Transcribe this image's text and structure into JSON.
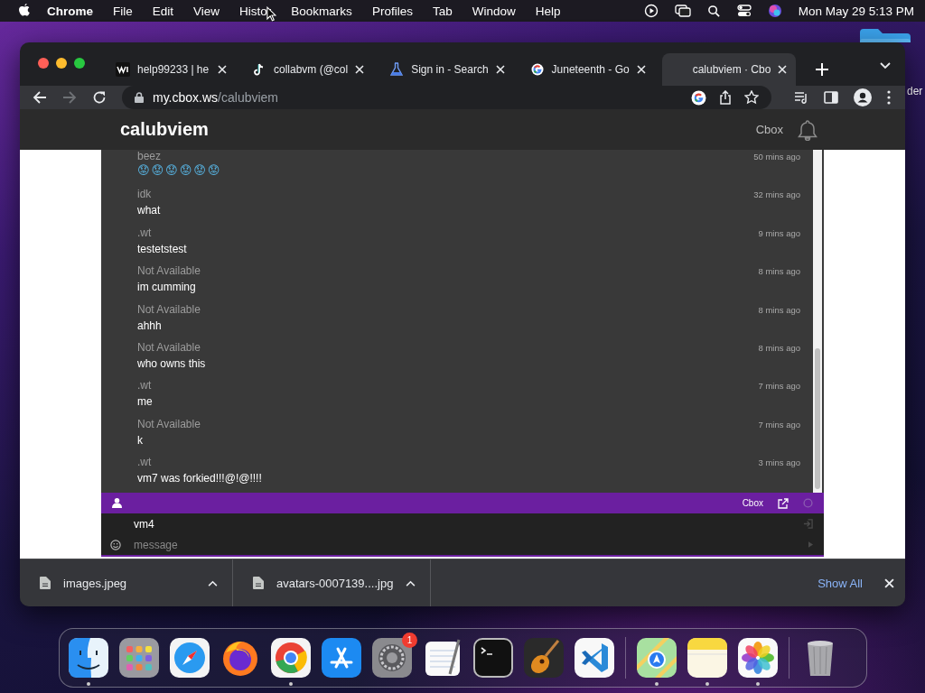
{
  "menu_bar": {
    "app": "Chrome",
    "menus": [
      "File",
      "Edit",
      "View",
      "Histor",
      "Bookmarks",
      "Profiles",
      "Tab",
      "Window",
      "Help"
    ],
    "clock": "Mon May 29  5:13 PM"
  },
  "desktop": {
    "folder_label": "der"
  },
  "tabs": [
    {
      "title": "help99233 | he",
      "kind": "wix",
      "selected": false
    },
    {
      "title": "collabvm (@col",
      "kind": "note",
      "selected": false
    },
    {
      "title": "Sign in - Search",
      "kind": "flask",
      "selected": false
    },
    {
      "title": "Juneteenth - Go",
      "kind": "google",
      "selected": false
    },
    {
      "title": "calubviem · Cbo",
      "selected": true
    }
  ],
  "toolbar": {
    "back_enabled": true,
    "forward_enabled": false,
    "host": "my.cbox.ws",
    "path": "/calubviem"
  },
  "page": {
    "site_title": "calubviem",
    "header_link": "Cbox",
    "messages": [
      {
        "author": "beez",
        "time": "50 mins ago",
        "text": "😟😟😟😟😟😟",
        "kind": "emoji"
      },
      {
        "author": "idk",
        "time": "32 mins ago",
        "text": "what"
      },
      {
        "author": ".wt",
        "time": "9 mins ago",
        "text": "testetstest"
      },
      {
        "author": "Not Available",
        "time": "8 mins ago",
        "text": "im cumming"
      },
      {
        "author": "Not Available",
        "time": "8 mins ago",
        "text": "ahhh"
      },
      {
        "author": "Not Available",
        "time": "8 mins ago",
        "text": "who owns this"
      },
      {
        "author": ".wt",
        "time": "7 mins ago",
        "text": "me"
      },
      {
        "author": "Not Available",
        "time": "7 mins ago",
        "text": "k"
      },
      {
        "author": ".wt",
        "time": "3 mins ago",
        "text": "vm7 was forkied!!!@!@!!!!"
      }
    ],
    "bar_label": "Cbox",
    "name_value": "vm4",
    "message_placeholder": "message"
  },
  "downloads": {
    "items": [
      {
        "name": "images.jpeg"
      },
      {
        "name": "avatars-0007139....jpg"
      }
    ],
    "show_all": "Show All"
  },
  "dock": [
    {
      "kind": "finder",
      "running": true
    },
    {
      "kind": "launchpad",
      "running": false
    },
    {
      "kind": "safari",
      "running": false
    },
    {
      "kind": "firefox",
      "running": false
    },
    {
      "kind": "chrome",
      "running": true
    },
    {
      "kind": "appstore",
      "running": false
    },
    {
      "kind": "settings",
      "running": false,
      "badge": "1"
    },
    {
      "kind": "textedit",
      "running": false
    },
    {
      "kind": "terminal",
      "running": false
    },
    {
      "kind": "garageband",
      "running": false
    },
    {
      "kind": "vscode",
      "running": false
    },
    {
      "kind": "separator"
    },
    {
      "kind": "maps",
      "running": true
    },
    {
      "kind": "notes",
      "running": true
    },
    {
      "kind": "photos",
      "running": true
    },
    {
      "kind": "separator"
    },
    {
      "kind": "trash",
      "running": false
    }
  ]
}
